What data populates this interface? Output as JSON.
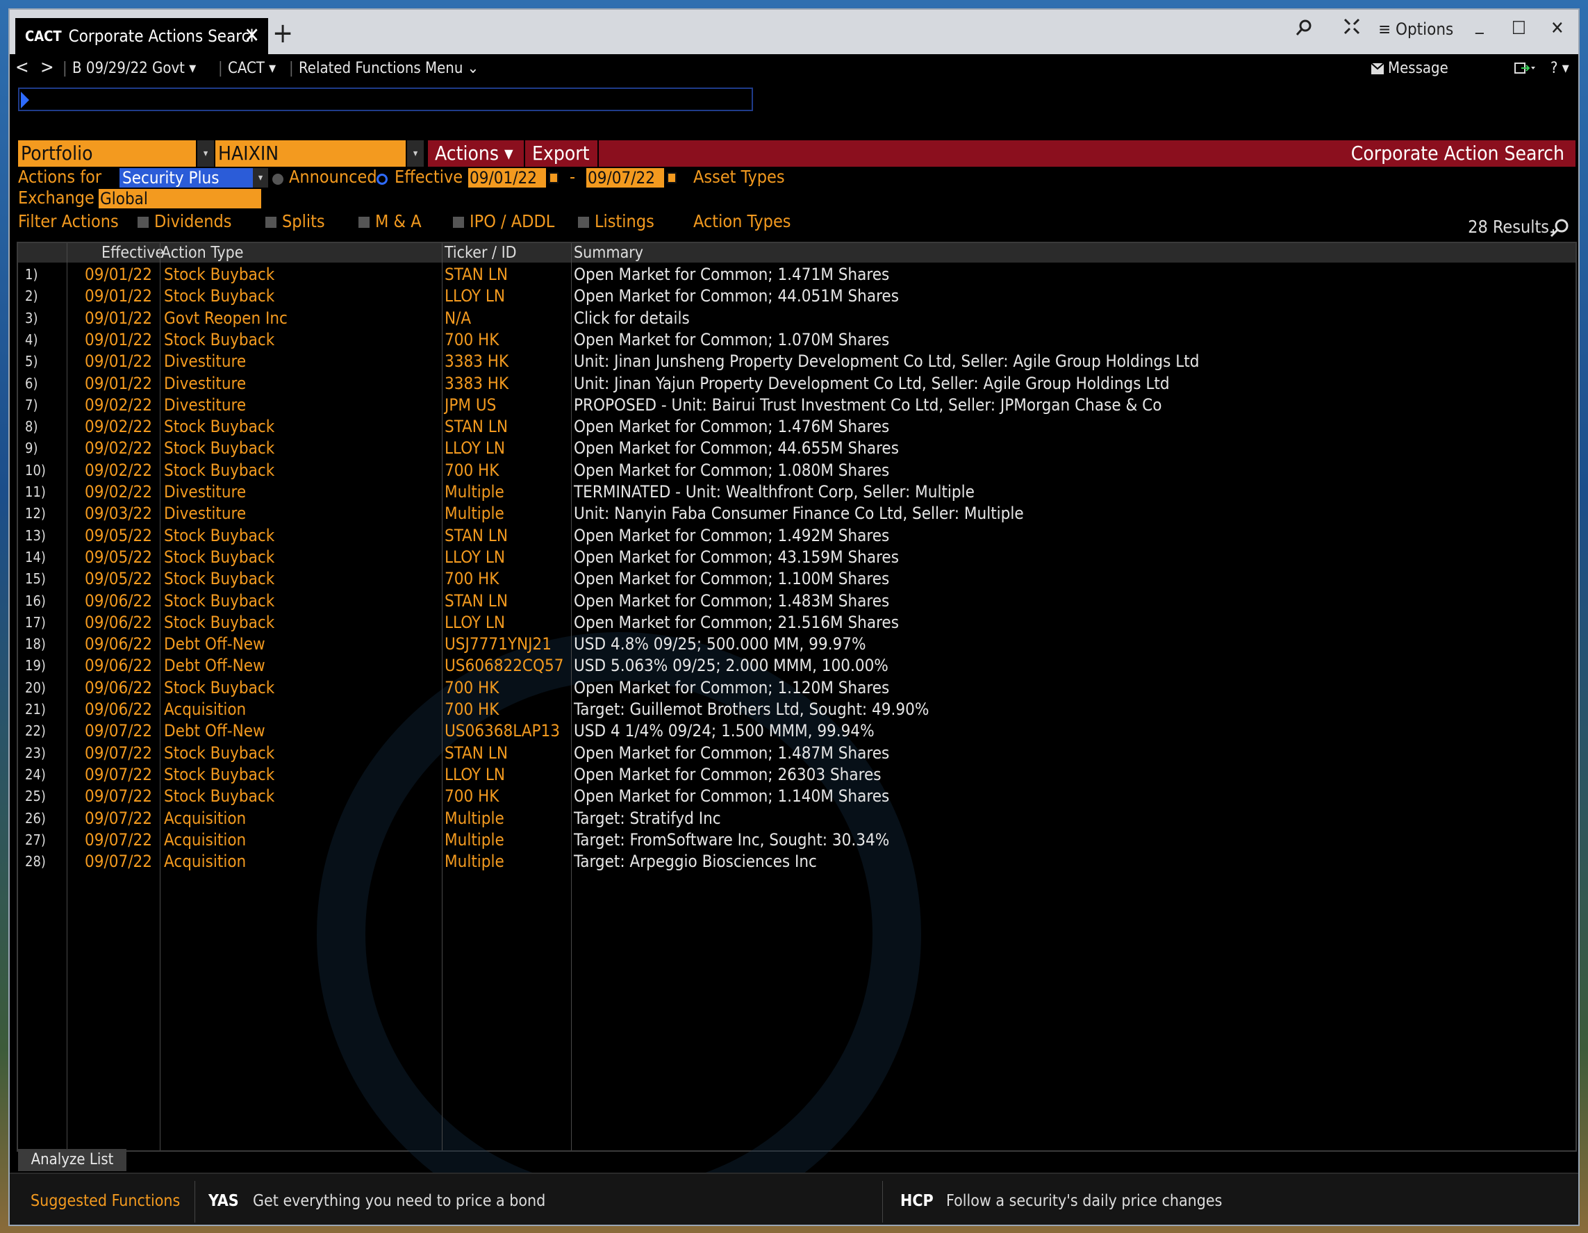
{
  "titlebar": {
    "tab_code": "CACT",
    "tab_title": "Corporate Actions Searcl",
    "close_glyph": "✕",
    "new_tab_glyph": "+",
    "options_label": "≡ Options",
    "minimize_glyph": "_",
    "maximize_glyph": "☐",
    "window_close_glyph": "✕"
  },
  "navbar": {
    "back": "<",
    "forward": ">",
    "security": "B 09/29/22 Govt ▾",
    "function": "CACT ▾",
    "related": "Related Functions Menu ⌄",
    "message": "Message",
    "help": "? ▾"
  },
  "header": {
    "portfolio_label": "Portfolio",
    "portfolio_value": "HAIXIN",
    "actions_button": "Actions ▾",
    "export_button": "Export",
    "title": "Corporate Action Search"
  },
  "filters": {
    "actions_for_label": "Actions for",
    "actions_for_value": "Security Plus",
    "announced_label": "Announced",
    "effective_label": "Effective",
    "date_from": "09/01/22",
    "date_sep": "-",
    "date_to": "09/07/22",
    "asset_types_label": "Asset Types",
    "exchange_label": "Exchange",
    "exchange_value": "Global",
    "filter_actions_label": "Filter Actions",
    "dividends": "Dividends",
    "splits": "Splits",
    "ma": "M & A",
    "ipo": "IPO / ADDL",
    "listings": "Listings",
    "action_types": "Action Types",
    "results": "28 Results"
  },
  "table": {
    "columns": [
      "Effective",
      "Action Type",
      "Ticker / ID",
      "Summary"
    ],
    "rows": [
      {
        "num": "1)",
        "effective": "09/01/22",
        "type": "Stock Buyback",
        "ticker": "STAN LN",
        "summary": "Open Market for Common; 1.471M Shares"
      },
      {
        "num": "2)",
        "effective": "09/01/22",
        "type": "Stock Buyback",
        "ticker": "LLOY LN",
        "summary": "Open Market for Common; 44.051M Shares"
      },
      {
        "num": "3)",
        "effective": "09/01/22",
        "type": "Govt Reopen Inc",
        "ticker": "N/A",
        "summary": "Click for details"
      },
      {
        "num": "4)",
        "effective": "09/01/22",
        "type": "Stock Buyback",
        "ticker": "700 HK",
        "summary": "Open Market for Common; 1.070M Shares"
      },
      {
        "num": "5)",
        "effective": "09/01/22",
        "type": "Divestiture",
        "ticker": "3383 HK",
        "summary": "Unit: Jinan Junsheng Property Development Co Ltd, Seller: Agile Group Holdings Ltd"
      },
      {
        "num": "6)",
        "effective": "09/01/22",
        "type": "Divestiture",
        "ticker": "3383 HK",
        "summary": "Unit: Jinan Yajun Property Development Co Ltd, Seller: Agile Group Holdings Ltd"
      },
      {
        "num": "7)",
        "effective": "09/02/22",
        "type": "Divestiture",
        "ticker": "JPM US",
        "summary": "PROPOSED - Unit: Bairui Trust Investment Co Ltd, Seller: JPMorgan Chase & Co"
      },
      {
        "num": "8)",
        "effective": "09/02/22",
        "type": "Stock Buyback",
        "ticker": "STAN LN",
        "summary": "Open Market for Common; 1.476M Shares"
      },
      {
        "num": "9)",
        "effective": "09/02/22",
        "type": "Stock Buyback",
        "ticker": "LLOY LN",
        "summary": "Open Market for Common; 44.655M Shares"
      },
      {
        "num": "10)",
        "effective": "09/02/22",
        "type": "Stock Buyback",
        "ticker": "700 HK",
        "summary": "Open Market for Common; 1.080M Shares"
      },
      {
        "num": "11)",
        "effective": "09/02/22",
        "type": "Divestiture",
        "ticker": "Multiple",
        "summary": "TERMINATED - Unit: Wealthfront Corp, Seller: Multiple"
      },
      {
        "num": "12)",
        "effective": "09/03/22",
        "type": "Divestiture",
        "ticker": "Multiple",
        "summary": "Unit: Nanyin Faba Consumer Finance Co Ltd, Seller: Multiple"
      },
      {
        "num": "13)",
        "effective": "09/05/22",
        "type": "Stock Buyback",
        "ticker": "STAN LN",
        "summary": "Open Market for Common; 1.492M Shares"
      },
      {
        "num": "14)",
        "effective": "09/05/22",
        "type": "Stock Buyback",
        "ticker": "LLOY LN",
        "summary": "Open Market for Common; 43.159M Shares"
      },
      {
        "num": "15)",
        "effective": "09/05/22",
        "type": "Stock Buyback",
        "ticker": "700 HK",
        "summary": "Open Market for Common; 1.100M Shares"
      },
      {
        "num": "16)",
        "effective": "09/06/22",
        "type": "Stock Buyback",
        "ticker": "STAN LN",
        "summary": "Open Market for Common; 1.483M Shares"
      },
      {
        "num": "17)",
        "effective": "09/06/22",
        "type": "Stock Buyback",
        "ticker": "LLOY LN",
        "summary": "Open Market for Common; 21.516M Shares"
      },
      {
        "num": "18)",
        "effective": "09/06/22",
        "type": "Debt Off-New",
        "ticker": "USJ7771YNJ21",
        "summary": "USD 4.8% 09/25; 500.000 MM, 99.97%"
      },
      {
        "num": "19)",
        "effective": "09/06/22",
        "type": "Debt Off-New",
        "ticker": "US606822CQ57",
        "summary": "USD 5.063% 09/25; 2.000 MMM, 100.00%"
      },
      {
        "num": "20)",
        "effective": "09/06/22",
        "type": "Stock Buyback",
        "ticker": "700 HK",
        "summary": "Open Market for Common; 1.120M Shares"
      },
      {
        "num": "21)",
        "effective": "09/06/22",
        "type": "Acquisition",
        "ticker": "700 HK",
        "summary": "Target: Guillemot Brothers Ltd, Sought: 49.90%"
      },
      {
        "num": "22)",
        "effective": "09/07/22",
        "type": "Debt Off-New",
        "ticker": "US06368LAP13",
        "summary": "USD 4 1/4% 09/24; 1.500 MMM, 99.94%"
      },
      {
        "num": "23)",
        "effective": "09/07/22",
        "type": "Stock Buyback",
        "ticker": "STAN LN",
        "summary": "Open Market for Common; 1.487M Shares"
      },
      {
        "num": "24)",
        "effective": "09/07/22",
        "type": "Stock Buyback",
        "ticker": "LLOY LN",
        "summary": "Open Market for Common; 26303 Shares"
      },
      {
        "num": "25)",
        "effective": "09/07/22",
        "type": "Stock Buyback",
        "ticker": "700 HK",
        "summary": "Open Market for Common; 1.140M Shares"
      },
      {
        "num": "26)",
        "effective": "09/07/22",
        "type": "Acquisition",
        "ticker": "Multiple",
        "summary": "Target: Stratifyd Inc"
      },
      {
        "num": "27)",
        "effective": "09/07/22",
        "type": "Acquisition",
        "ticker": "Multiple",
        "summary": "Target: FromSoftware Inc, Sought: 30.34%"
      },
      {
        "num": "28)",
        "effective": "09/07/22",
        "type": "Acquisition",
        "ticker": "Multiple",
        "summary": "Target: Arpeggio Biosciences Inc"
      }
    ]
  },
  "bottom": {
    "analyze_list": "Analyze List",
    "suggested": "Suggested Functions",
    "yas_code": "YAS",
    "yas_desc": "Get everything you need to price a bond",
    "hcp_code": "HCP",
    "hcp_desc": "Follow a security's daily price changes"
  },
  "colors": {
    "accent_orange": "#f39a1f",
    "header_red": "#8b0f1e",
    "background": "#000000"
  }
}
